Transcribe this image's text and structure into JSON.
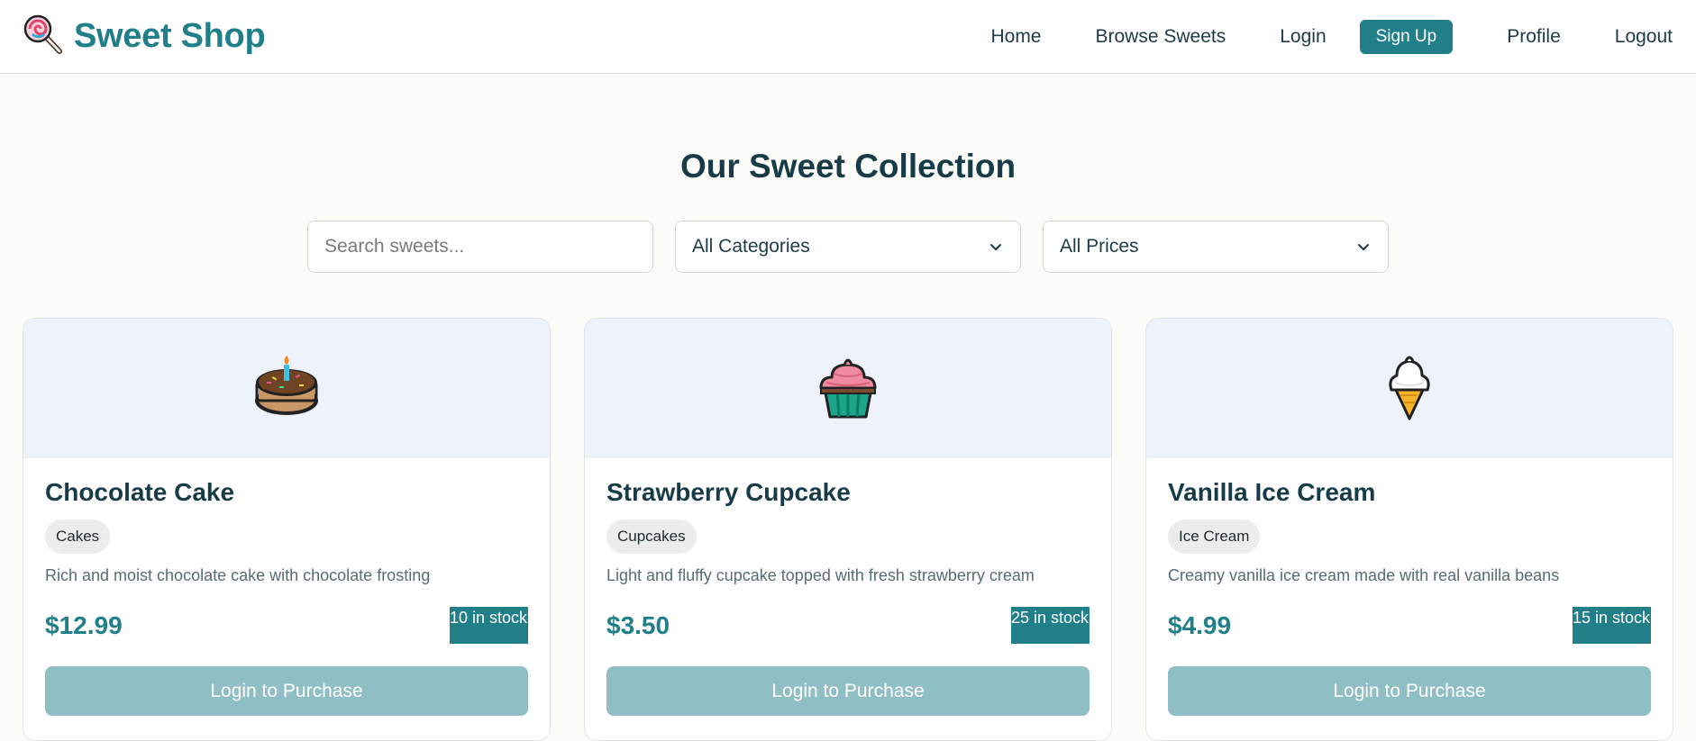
{
  "brand": {
    "name": "Sweet Shop",
    "icon": "lollipop-icon",
    "color": "#217f8a"
  },
  "nav": {
    "home": "Home",
    "browse": "Browse Sweets",
    "login": "Login",
    "signup": "Sign Up",
    "profile": "Profile",
    "logout": "Logout"
  },
  "page": {
    "title": "Our Sweet Collection"
  },
  "filters": {
    "search_placeholder": "Search sweets...",
    "category_selected": "All Categories",
    "price_selected": "All Prices"
  },
  "products": [
    {
      "name": "Chocolate Cake",
      "category": "Cakes",
      "description": "Rich and moist chocolate cake with chocolate frosting",
      "price": "$12.99",
      "stock": "10 in stock",
      "action": "Login to Purchase",
      "icon": "birthday-cake-icon"
    },
    {
      "name": "Strawberry Cupcake",
      "category": "Cupcakes",
      "description": "Light and fluffy cupcake topped with fresh strawberry cream",
      "price": "$3.50",
      "stock": "25 in stock",
      "action": "Login to Purchase",
      "icon": "cupcake-icon"
    },
    {
      "name": "Vanilla Ice Cream",
      "category": "Ice Cream",
      "description": "Creamy vanilla ice cream made with real vanilla beans",
      "price": "$4.99",
      "stock": "15 in stock",
      "action": "Login to Purchase",
      "icon": "ice-cream-cone-icon"
    }
  ],
  "colors": {
    "accent": "#217f8a",
    "disabled_button": "#8fbfc5",
    "card_image_bg": "#eef3fb"
  }
}
